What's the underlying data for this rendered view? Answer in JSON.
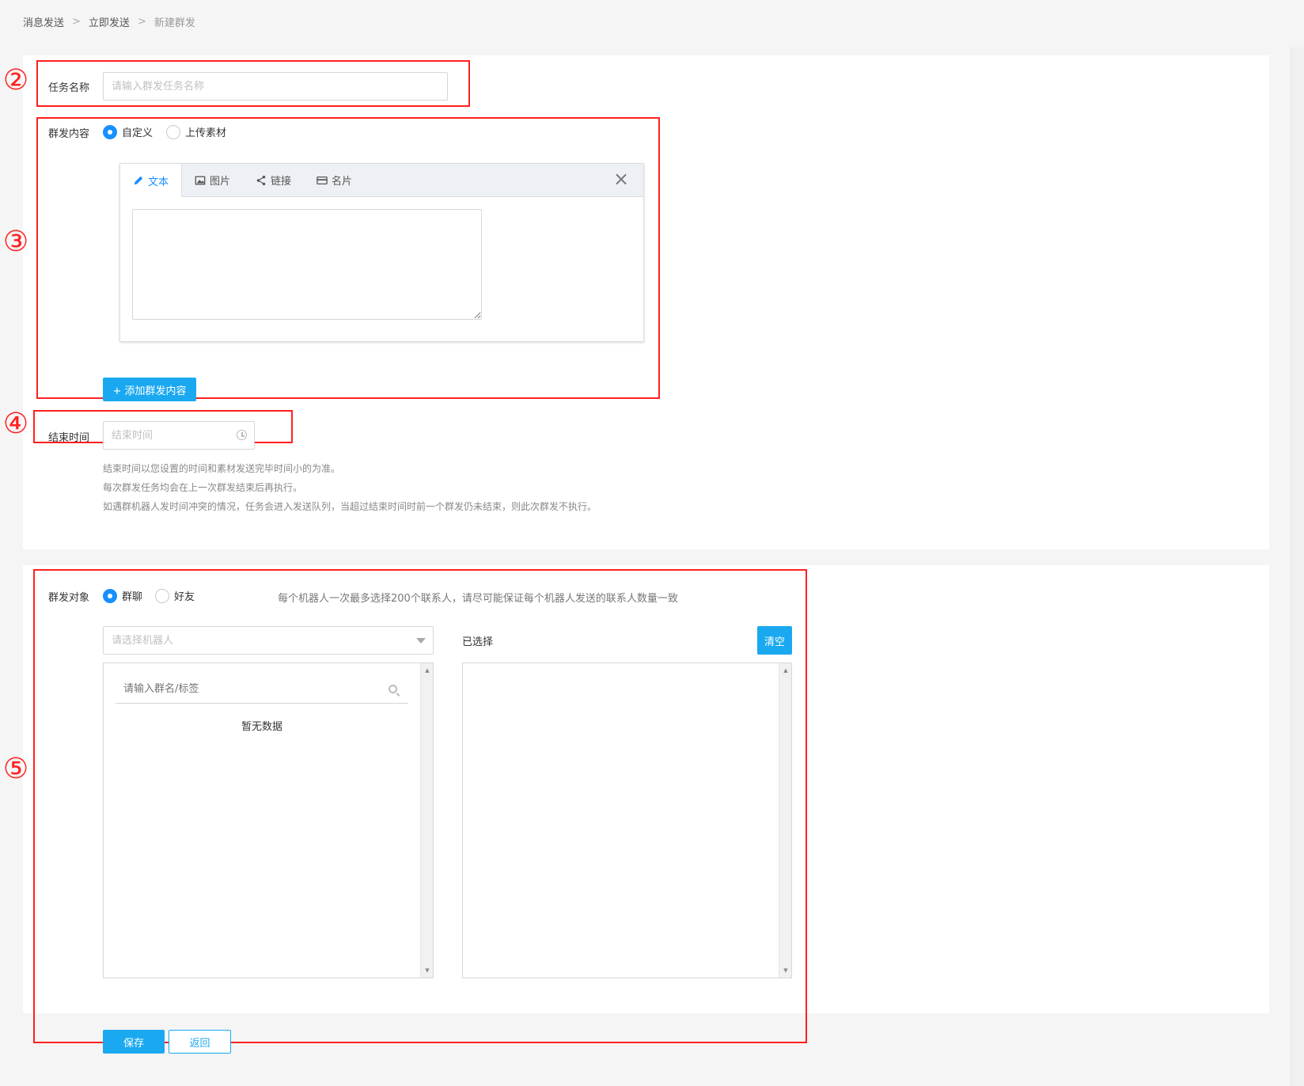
{
  "breadcrumb": {
    "items": [
      "消息发送",
      "立即发送",
      "新建群发"
    ],
    "separator": ">"
  },
  "annotations": [
    "②",
    "③",
    "④",
    "⑤"
  ],
  "task_name": {
    "label": "任务名称",
    "placeholder": "请输入群发任务名称"
  },
  "content": {
    "label": "群发内容",
    "options": [
      "自定义",
      "上传素材"
    ],
    "selected": "自定义",
    "tabs": [
      "文本",
      "图片",
      "链接",
      "名片"
    ],
    "active_tab": "文本",
    "add_button": "+ 添加群发内容"
  },
  "end_time": {
    "label": "结束时间",
    "placeholder": "结束时间",
    "hints": [
      "结束时间以您设置的时间和素材发送完毕时间小的为准。",
      "每次群发任务均会在上一次群发结束后再执行。",
      "如遇群机器人发时间冲突的情况，任务会进入发送队列，当超过结束时间时前一个群发仍未结束，则此次群发不执行。"
    ]
  },
  "target": {
    "label": "群发对象",
    "options": [
      "群聊",
      "好友"
    ],
    "selected": "群聊",
    "note": "每个机器人一次最多选择200个联系人，请尽可能保证每个机器人发送的联系人数量一致",
    "robot_placeholder": "请选择机器人",
    "search_placeholder": "请输入群名/标签",
    "empty_text": "暂无数据",
    "selected_title": "已选择",
    "clear_button": "清空"
  },
  "footer": {
    "save": "保存",
    "back": "返回"
  },
  "colors": {
    "primary": "#1aa9f0",
    "radio_checked": "#1890ff",
    "annotation": "#ff2020"
  }
}
